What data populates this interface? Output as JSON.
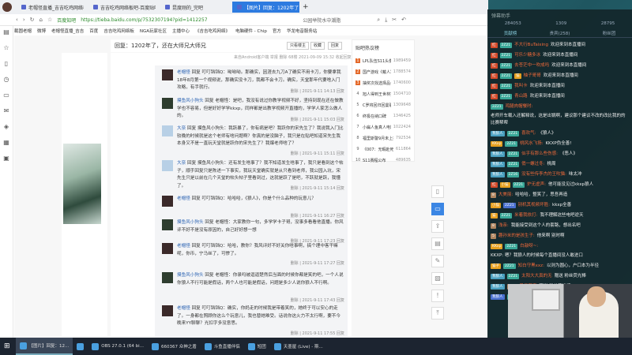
{
  "browser": {
    "tabs": [
      "老帽怪直播_吉吉吃鸡网络板直播_头",
      "吉吉吃鸡网络板吧-百度贴吧--热爱",
      "昆度刚的_完吧",
      "【图片】回复：1202年了，还在大"
    ],
    "active_tab": 3,
    "site_label": "百度知吧",
    "url": "https://tieba.baidu.com/p/7532307194?pid=141225718094&cid=141252794255&red_tag=2825",
    "search_hint": "公园举院水中潮脂",
    "bookmarks": [
      "截圆老帽",
      "微博",
      "老帽怪直播_吉吉",
      "百度",
      "吉吉吃鸡网络板",
      "NGA玩家社区",
      "主播中心",
      "《吉吉吃鸡网络》",
      "电脑硬件 - Chip",
      "官方",
      "华龙电音服务站"
    ]
  },
  "thread": {
    "title": "回复：1202年了，还在大师兄大师兄",
    "btn_louzhu": "只看楼主",
    "btn_fav": "收藏",
    "btn_reply": "回复",
    "meta": "来自Android客户端  举报  删除  68楼  2021-09-09 15:32   收起回复",
    "posts": [
      {
        "name": "老帽怪",
        "text": "回复 叮叮铛铛Q：呦呦呦。那确实，因涯去九刀A了确实不用卡刀，你要拿我18年8月第一个视频说，那确实没卡刀，我都不会卡刀。确实，天堂那年代要啥入门攻略，有手就行。",
        "time": "删除 | 2021-9-11 14:13 回复",
        "av": ""
      },
      {
        "name": "摸鱼风小狗头",
        "text": "回复 老帽怪：是吧，我没有说过你教学视频不好，坚持到现在还在做教学也不容易，但是好好学学kkxp，同样都是出教学视频开直播的，学学人家怎么做人的。",
        "time": "删除 | 2021-9-11 15:03 回复",
        "av": "g"
      },
      {
        "name": "大奈",
        "text": "回复 摸鱼风小狗头：我跃暴了，你有病是吧？我跃你的宋先生了？我说我入门比较晚的时候就是这个老师有啥问题啊？你真的是没脑子，我只是在贴吧知道宋先生我本身又不是一直玩天堂就是跃你的宋先生了？我爆老师啥了？",
        "time": "删除 | 2021-9-11 15:11 回复",
        "av": "b"
      },
      {
        "name": "大奈",
        "text": "回复 摸鱼风小狗头：还有发生啥事了？我不知道发生啥事了，我只是看到这个帖子，顺手回复只是陈述一下事实，我玩天堂确实就是从只看到老师，我公园入坑，宋先生只是以前在几个天堂的帖头帖子里看到过，这就是跃了是吧，不跃就是跃，我懂了。",
        "time": "删除 | 2021-9-11 15:14 回复",
        "av": "b"
      },
      {
        "name": "老帽怪",
        "text": "回复 叮叮铛铛Q：哈哈哈，《狼人》，你是个什么品种的玩意儿？",
        "time": "删除 | 2021-9-11 16:27 回复",
        "av": ""
      },
      {
        "name": "摸鱼风小狗头",
        "text": "回复 老帽怪：大家教你一句，多学学卡子哥，没事多看看他直播。你风评不好不是没有原因的，自己好好想一想",
        "time": "删除 | 2021-9-11 17:23 回复",
        "av": "g"
      },
      {
        "name": "老帽怪",
        "text": "回复 叮叮铛铛Q：哈哈，教你？我风评好不好关你啥事啊，搞个理中客干嘛呢，你币，宁马丝了，可惨了。",
        "time": "删除 | 2021-9-11 17:27 回复",
        "av": ""
      },
      {
        "name": "摸鱼风小狗头",
        "text": "回复 老帽怪：你录吗被逗逼楚然后当面的时候你都是笑的吧，一个人说你狼人不行可能是假话，两个人也可能是假话，问题是多少人说你狼人不行啊。",
        "time": "删除 | 2021-9-11 17:43 回复",
        "av": "g"
      },
      {
        "name": "老帽怪",
        "text": "回复 叮叮铛铛Q：确实，你妈走的时候我是带着笑的，她终于可以安心的走了。一身都在照顾你这么个玩意儿，我也替她难受。话说你这火力不太行啊，要不今晚来YY聊聊？光扣字多没意思。",
        "time": "删除 | 2021-9-11 17:55 回复",
        "av": ""
      }
    ]
  },
  "hotlist": {
    "title": "贴吧热议榜",
    "items": [
      {
        "rank": "1",
        "title": "LPL队伍S11头像",
        "value": "1989459"
      },
      {
        "rank": "2",
        "title": "国产游戏《戴人》要...",
        "value": "1788574"
      },
      {
        "rank": "3",
        "title": "抽奖次找选择品会",
        "value": "1740600"
      },
      {
        "rank": "4",
        "title": "旭人得到王世林签约权",
        "value": "1504710"
      },
      {
        "rank": "5",
        "title": "C罗将回归回曼联",
        "value": "1309648"
      },
      {
        "rank": "6",
        "title": "终极在纳口碑",
        "value": "1346425"
      },
      {
        "rank": "7",
        "title": "小扁人鱼真人电影定档",
        "value": "1022424"
      },
      {
        "rank": "8",
        "title": "福里斯警9月未上播",
        "value": "792534"
      },
      {
        "rank": "9",
        "title": "《007：无暇赴死》...",
        "value": "611864"
      },
      {
        "rank": "10",
        "title": "S11赛程公布",
        "value": "489635"
      }
    ]
  },
  "tools": [
    "phone-icon",
    "comment-icon",
    "share-icon",
    "card-icon",
    "edit-icon",
    "image-icon",
    "report-icon",
    "top-icon"
  ],
  "chat": {
    "title": "弹幕助手",
    "stats": [
      "284053",
      "1309",
      "28795"
    ],
    "tabs": [
      "贡献榜",
      "贵宾(258)",
      "粉丝团"
    ],
    "messages": [
      {
        "badges": [
          [
            "红",
            "red"
          ],
          [
            "2Z21",
            "lvl"
          ]
        ],
        "nick": "不大行BuTaixing",
        "text": "欢迎来到本直播间"
      },
      {
        "badges": [
          [
            "红",
            "red"
          ],
          [
            "2Z21",
            "lvl"
          ]
        ],
        "nick": "可乐少糖多冰",
        "text": "欢迎来到本直播间"
      },
      {
        "badges": [
          [
            "红",
            "red"
          ],
          [
            "2Z21",
            "lvl"
          ]
        ],
        "nick": "去苍茫中一吹成吗",
        "text": "欢迎来到本直播间"
      },
      {
        "badges": [
          [
            "红",
            "red"
          ],
          [
            "2Z21",
            "lvl"
          ],
          [
            "猫",
            "gold"
          ]
        ],
        "nick": "柚子哥哥",
        "text": "欢迎来到本直播间"
      },
      {
        "badges": [
          [
            "红",
            "red"
          ],
          [
            "2Z21",
            "lvl"
          ]
        ],
        "nick": "我叫卡",
        "text": "欢迎来到本直播间"
      },
      {
        "badges": [
          [
            "红",
            "red"
          ],
          [
            "2Z21",
            "lvl"
          ]
        ],
        "nick": "青山路",
        "text": "欢迎来到本直播间"
      },
      {
        "badges": [
          [
            "2Z21",
            "lvl"
          ]
        ],
        "nick": "鸡腿肉帽餐时:",
        "text": "老师开车载入还解释说，这是出锅啊，建议那个建议不改的改比我的的比赛帮帮"
      },
      {
        "badges": [
          [
            "我狼人",
            "fan"
          ],
          [
            "2Z21",
            "lvl"
          ]
        ],
        "nick": "喜欢气:",
        "text": "《狼人》"
      },
      {
        "badges": [
          [
            "KKxp",
            "gold"
          ],
          [
            "2Z21",
            "lvl"
          ]
        ],
        "nick": "桃风水飞扬:",
        "text": "KKXP伪全善!"
      },
      {
        "badges": [
          [
            "我狼人",
            "fan"
          ],
          [
            "2Z21",
            "lvl"
          ]
        ],
        "nick": "似乎有那么些伤感:",
        "text": "《恶人》"
      },
      {
        "badges": [
          [
            "我狼人",
            "fan"
          ],
          [
            "2Z21",
            "lvl"
          ]
        ],
        "nick": "俏一螺过冬:",
        "text": "桃周"
      },
      {
        "badges": [
          [
            "我狼人",
            "fan"
          ],
          [
            "2Z16",
            "lvl"
          ]
        ],
        "nick": "没有些传李杰的王吹猫:",
        "text": "味太冲"
      },
      {
        "badges": [
          [
            "红",
            "red"
          ],
          [
            "小猫",
            "gold"
          ],
          [
            "2Z21",
            "lvl"
          ]
        ],
        "nick": "炉无虚声:",
        "text": "他可能没见过kkxp狼人"
      },
      {
        "badges": [
          [
            "8",
            "tan"
          ]
        ],
        "nick": "大美丽:",
        "text": "哈哈哈，整笑了，思吾再造"
      },
      {
        "badges": [
          [
            "小猫",
            "gold"
          ],
          [
            "2Z21",
            "blue"
          ]
        ],
        "nick": "别机其视频坏胜:",
        "text": "kkxp全善"
      },
      {
        "badges": [
          [
            "猫",
            "gold"
          ],
          [
            "2Z21",
            "lvl"
          ]
        ],
        "nick": "米着我依打:",
        "text": "我不理解这些电吧逆天"
      },
      {
        "badges": [
          [
            "8",
            "tan"
          ]
        ],
        "nick": "浅亲:",
        "text": "我能接受到这个人的套路，想出名吧"
      },
      {
        "badges": [
          [
            "5",
            "tan"
          ]
        ],
        "nick": "趣孙米的是孩生子:",
        "text": "他来啊 别时啊"
      },
      {
        "badges": [
          [
            "KKxp",
            "gold"
          ],
          [
            "2Z21",
            "lvl"
          ]
        ],
        "nick": "白敲呀~:",
        "text": "KKXP: 嗯？我狼人的时候每个直播间没人敢进口"
      },
      {
        "badges": [
          [
            "猫子",
            "gold"
          ],
          [
            "2Z21",
            "lvl"
          ]
        ],
        "nick": "知白守黑xxz:",
        "text": "以则为圆心，户口本为半径"
      },
      {
        "badges": [
          [
            "我狼人",
            "fan"
          ],
          [
            "2Z21",
            "lvl"
          ]
        ],
        "nick": "太阳大大真的无",
        "text": "赠送 粉丝荧光棒"
      },
      {
        "badges": [
          [
            "我狼人",
            "fan"
          ],
          [
            "2Z0",
            "tan"
          ]
        ],
        "nick": "果子芝麻",
        "text": "赠送 粉丝荧光棒 x25"
      },
      {
        "badges": [
          [
            "我狼人",
            "blue"
          ],
          [
            "2Z16",
            "lvl"
          ]
        ],
        "nick": "Aurobby",
        "text": "赠送 饭团"
      }
    ]
  },
  "taskbar": {
    "items": [
      "【图片】回复：12...",
      "",
      "OBS 27.0.1 (64 bi...",
      "660367 众神之盾",
      "斗鱼直播伴侣",
      "短团",
      "天墨屋 (Live) - 斯..."
    ],
    "active": 0
  }
}
